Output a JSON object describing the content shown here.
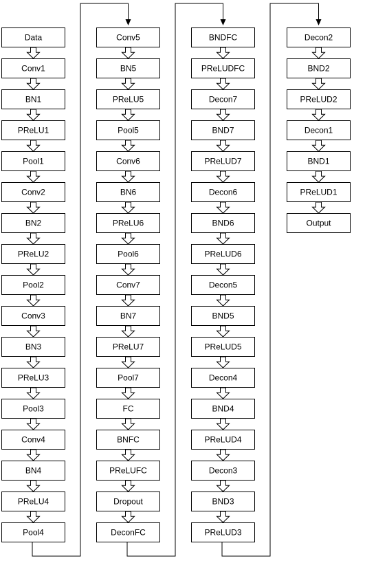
{
  "columns": [
    {
      "id": "col1",
      "boxes": [
        "Data",
        "Conv1",
        "BN1",
        "PReLU1",
        "Pool1",
        "Conv2",
        "BN2",
        "PReLU2",
        "Pool2",
        "Conv3",
        "BN3",
        "PReLU3",
        "Pool3",
        "Conv4",
        "BN4",
        "PReLU4",
        "Pool4"
      ]
    },
    {
      "id": "col2",
      "boxes": [
        "Conv5",
        "BN5",
        "PReLU5",
        "Pool5",
        "Conv6",
        "BN6",
        "PReLU6",
        "Pool6",
        "Conv7",
        "BN7",
        "PReLU7",
        "Pool7",
        "FC",
        "BNFC",
        "PReLUFC",
        "Dropout",
        "DeconFC"
      ]
    },
    {
      "id": "col3",
      "boxes": [
        "BNDFC",
        "PReLUDFC",
        "Decon7",
        "BND7",
        "PReLUD7",
        "Decon6",
        "BND6",
        "PReLUD6",
        "Decon5",
        "BND5",
        "PReLUD5",
        "Decon4",
        "BND4",
        "PReLUD4",
        "Decon3",
        "BND3",
        "PReLUD3"
      ]
    },
    {
      "id": "col4",
      "boxes": [
        "Decon2",
        "BND2",
        "PReLUD2",
        "Decon1",
        "BND1",
        "PReLUD1",
        "Output"
      ]
    }
  ]
}
